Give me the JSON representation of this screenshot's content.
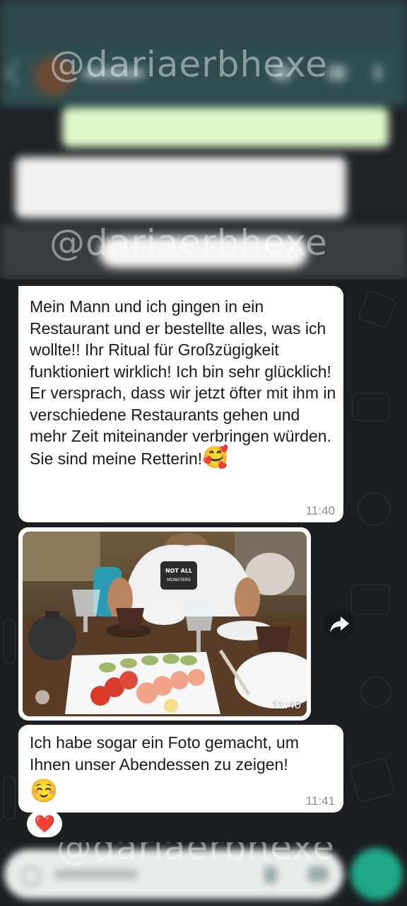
{
  "watermark": "@dariaerbhexe",
  "messages": [
    {
      "text": "Mein Mann und ich gingen in ein Restaurant und er bestellte alles, was ich wollte!! Ihr Ritual für Großzügigkeit funktioniert wirklich! Ich bin sehr glücklich! Er versprach, dass wir jetzt öfter mit ihm in verschiedene Restaurants gehen und mehr Zeit miteinander verbringen würden. Sie sind meine Retterin!",
      "emoji": "🥰",
      "time": "11:40"
    },
    {
      "type": "photo",
      "photo_description_icon": "restaurant-photo",
      "shirt_text": "NOT ALL MONSTERS DO MONSTROUS THINGS",
      "time": "11:40"
    },
    {
      "text": "Ich habe sogar ein Foto gemacht, um Ihnen unser Abendessen zu zeigen!",
      "emoji": "☺️",
      "time": "11:41",
      "reaction": "❤️"
    }
  ],
  "colors": {
    "header": "#2f4d4f",
    "bubble_incoming": "#ffffff",
    "chat_background": "#1b1f22",
    "send_button": "#1fa887"
  },
  "icons": [
    "back-arrow-icon",
    "forward-share-icon",
    "mic-icon",
    "emoji-icon",
    "attach-icon",
    "camera-icon"
  ]
}
